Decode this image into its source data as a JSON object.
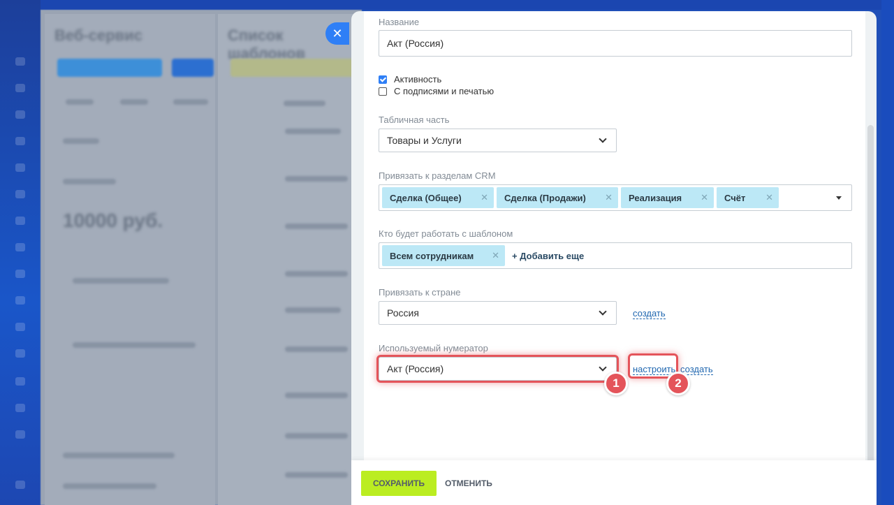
{
  "background": {
    "left_title": "Веб-сервис",
    "left_subtitle": "10000 руб.",
    "right_title": "Список шаблонов"
  },
  "panel": {
    "close_icon": "close-icon",
    "name_label": "Название",
    "name_value": "Акт (Россия)",
    "checkbox_active": {
      "label": "Активность",
      "checked": true
    },
    "checkbox_sign": {
      "label": "С подписями и печатью",
      "checked": false
    },
    "table_label": "Табличная часть",
    "table_value": "Товары и Услуги",
    "crm_label": "Привязать к разделам CRM",
    "crm_tags": [
      "Сделка (Общее)",
      "Сделка (Продажи)",
      "Реализация",
      "Счёт"
    ],
    "users_label": "Кто будет работать с шаблоном",
    "users_tags": [
      "Всем сотрудникам"
    ],
    "users_add": "+ Добавить еще",
    "country_label": "Привязать к стране",
    "country_value": "Россия",
    "country_create": "создать",
    "numerator_label": "Используемый нумератор",
    "numerator_value": "Акт (Россия)",
    "numerator_configure": "настроить",
    "numerator_create": "создать",
    "badge_1": "1",
    "badge_2": "2"
  },
  "footer": {
    "save_label": "СОХРАНИТЬ",
    "cancel_label": "ОТМЕНИТЬ"
  },
  "colors": {
    "accent": "#2f7ff6",
    "save": "#bbed21",
    "highlight": "#e4545a",
    "tag": "#bce8f6"
  }
}
